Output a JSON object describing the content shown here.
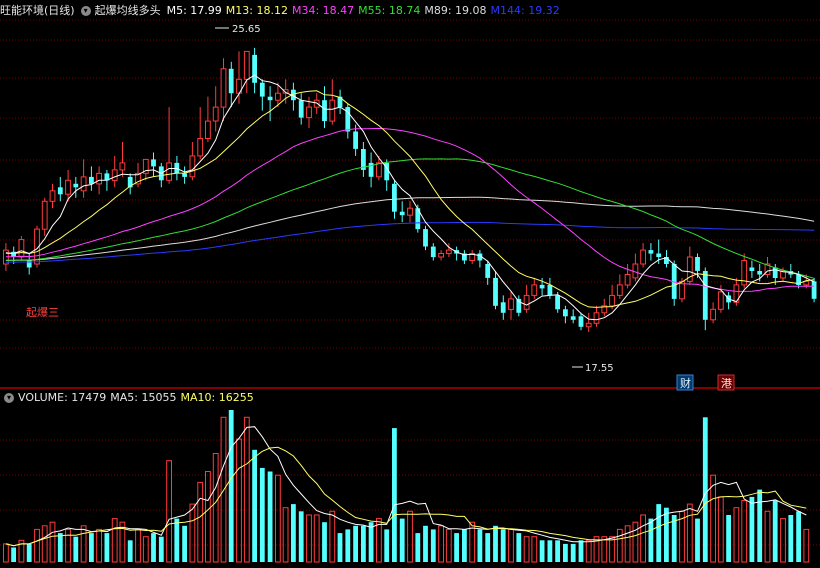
{
  "colors": {
    "bg": "#000000",
    "grid": "#7a0000",
    "up": "#ff3b3b",
    "down": "#54ffff",
    "m5": "#ffffff",
    "m13": "#ffff66",
    "m34": "#ff40ff",
    "m55": "#33dd33",
    "m89": "#dcdcdc",
    "m144": "#2a3aff",
    "ma5": "#ffffff",
    "ma10": "#ffff66",
    "text": "#e6e6e6"
  },
  "header": {
    "title": "旺能环境(日线)",
    "indicator": "起爆均线多头",
    "m5": "M5: 17.99",
    "m13": "M13: 18.12",
    "m34": "M34: 18.47",
    "m55": "M55: 18.74",
    "m89": "M89: 19.08",
    "m144": "M144: 19.32"
  },
  "volume_header": {
    "volume": "VOLUME: 17479",
    "ma5": "MA5: 15055",
    "ma10": "MA10: 16255"
  },
  "annotations": {
    "high": "25.65",
    "low": "17.55",
    "signal": "起爆三",
    "badge1": "财",
    "badge2": "港"
  },
  "icons": {
    "menu": "chevron-down-icon"
  },
  "chart_data": [
    {
      "type": "candlestick",
      "title": "旺能环境(日线)",
      "ylim": [
        16.0,
        26.5
      ],
      "series": [
        "M5",
        "M13",
        "M34",
        "M55",
        "M89",
        "M144"
      ],
      "candles": [
        [
          19.5,
          19.9,
          20.1,
          19.3
        ],
        [
          19.85,
          19.7,
          20.0,
          19.5
        ],
        [
          19.7,
          20.2,
          20.3,
          19.6
        ],
        [
          19.6,
          19.4,
          19.8,
          19.2
        ],
        [
          19.5,
          20.5,
          20.6,
          19.4
        ],
        [
          20.5,
          21.3,
          21.4,
          20.3
        ],
        [
          21.3,
          21.6,
          21.8,
          21.1
        ],
        [
          21.7,
          21.5,
          22.0,
          21.3
        ],
        [
          21.5,
          21.9,
          22.2,
          21.3
        ],
        [
          21.8,
          21.7,
          22.0,
          21.4
        ],
        [
          21.6,
          22.0,
          22.5,
          21.4
        ],
        [
          22.0,
          21.8,
          22.3,
          21.6
        ],
        [
          21.8,
          22.1,
          22.3,
          21.5
        ],
        [
          22.1,
          21.9,
          22.2,
          21.6
        ],
        [
          21.9,
          22.2,
          22.6,
          21.7
        ],
        [
          22.2,
          22.4,
          23.0,
          22.0
        ],
        [
          22.0,
          21.7,
          22.1,
          21.5
        ],
        [
          21.8,
          22.1,
          22.4,
          21.7
        ],
        [
          22.1,
          22.5,
          22.5,
          21.9
        ],
        [
          22.5,
          22.3,
          22.7,
          22.0
        ],
        [
          22.3,
          21.9,
          22.4,
          21.7
        ],
        [
          21.9,
          22.4,
          24.0,
          21.8
        ],
        [
          22.4,
          22.1,
          22.6,
          21.9
        ],
        [
          22.1,
          22.0,
          22.3,
          21.8
        ],
        [
          22.0,
          22.6,
          23.0,
          21.9
        ],
        [
          22.6,
          23.1,
          24.0,
          22.5
        ],
        [
          23.1,
          23.6,
          24.3,
          23.0
        ],
        [
          23.6,
          24.0,
          24.6,
          23.3
        ],
        [
          24.0,
          25.1,
          25.4,
          23.6
        ],
        [
          25.1,
          24.4,
          25.3,
          24.0
        ],
        [
          24.4,
          24.8,
          25.6,
          24.1
        ],
        [
          24.8,
          25.6,
          25.6,
          24.4
        ],
        [
          25.5,
          24.7,
          25.7,
          24.4
        ],
        [
          24.7,
          24.3,
          24.8,
          23.9
        ],
        [
          24.3,
          24.2,
          24.6,
          23.6
        ],
        [
          24.2,
          24.4,
          24.7,
          24.0
        ],
        [
          24.4,
          24.5,
          24.8,
          24.1
        ],
        [
          24.5,
          24.2,
          24.7,
          23.9
        ],
        [
          24.2,
          23.7,
          24.4,
          23.5
        ],
        [
          23.7,
          24.0,
          24.3,
          23.4
        ],
        [
          24.0,
          24.2,
          24.4,
          23.8
        ],
        [
          24.2,
          23.6,
          24.6,
          23.4
        ],
        [
          23.6,
          24.2,
          24.8,
          23.5
        ],
        [
          24.3,
          24.0,
          24.5,
          23.8
        ],
        [
          24.0,
          23.3,
          24.1,
          23.1
        ],
        [
          23.3,
          22.8,
          23.5,
          22.6
        ],
        [
          22.8,
          22.2,
          23.0,
          22.0
        ],
        [
          22.4,
          22.0,
          22.7,
          21.7
        ],
        [
          22.0,
          22.4,
          22.6,
          21.9
        ],
        [
          22.4,
          21.9,
          22.5,
          21.6
        ],
        [
          21.8,
          21.0,
          21.9,
          20.8
        ],
        [
          21.0,
          20.9,
          21.3,
          20.7
        ],
        [
          20.9,
          21.1,
          21.3,
          20.7
        ],
        [
          21.1,
          20.5,
          21.2,
          20.4
        ],
        [
          20.5,
          20.0,
          20.6,
          19.9
        ],
        [
          20.0,
          19.7,
          20.1,
          19.6
        ],
        [
          19.7,
          19.8,
          19.9,
          19.6
        ],
        [
          19.8,
          19.9,
          20.1,
          19.7
        ],
        [
          19.9,
          19.8,
          20.0,
          19.6
        ],
        [
          19.8,
          19.6,
          19.9,
          19.5
        ],
        [
          19.6,
          19.8,
          19.9,
          19.5
        ],
        [
          19.8,
          19.6,
          19.9,
          19.4
        ],
        [
          19.5,
          19.1,
          19.6,
          18.9
        ],
        [
          19.1,
          18.3,
          19.3,
          18.2
        ],
        [
          18.4,
          18.1,
          18.6,
          17.9
        ],
        [
          18.2,
          18.5,
          18.7,
          17.9
        ],
        [
          18.5,
          18.1,
          18.6,
          18.0
        ],
        [
          18.2,
          18.6,
          18.9,
          18.1
        ],
        [
          18.6,
          18.9,
          19.1,
          18.5
        ],
        [
          18.9,
          18.8,
          19.1,
          18.6
        ],
        [
          18.9,
          18.6,
          19.1,
          18.5
        ],
        [
          18.6,
          18.2,
          18.7,
          18.1
        ],
        [
          18.2,
          18.0,
          18.3,
          17.8
        ],
        [
          18.0,
          17.9,
          18.2,
          17.8
        ],
        [
          18.0,
          17.7,
          18.1,
          17.6
        ],
        [
          17.7,
          17.8,
          18.1,
          17.55
        ],
        [
          17.8,
          18.1,
          18.3,
          17.7
        ],
        [
          18.1,
          18.3,
          18.5,
          18.0
        ],
        [
          18.3,
          18.6,
          18.9,
          18.2
        ],
        [
          18.6,
          18.9,
          19.2,
          18.5
        ],
        [
          18.9,
          19.2,
          19.5,
          18.8
        ],
        [
          19.1,
          19.5,
          19.8,
          19.0
        ],
        [
          19.5,
          19.9,
          20.1,
          19.4
        ],
        [
          19.9,
          19.8,
          20.1,
          19.6
        ],
        [
          19.8,
          19.7,
          20.2,
          19.5
        ],
        [
          19.7,
          19.5,
          19.9,
          19.4
        ],
        [
          19.5,
          18.5,
          19.6,
          18.3
        ],
        [
          18.5,
          19.0,
          19.1,
          18.4
        ],
        [
          19.0,
          19.7,
          20.0,
          18.9
        ],
        [
          19.7,
          19.3,
          19.8,
          19.1
        ],
        [
          19.3,
          17.9,
          19.4,
          17.6
        ],
        [
          17.9,
          18.2,
          18.4,
          17.8
        ],
        [
          18.2,
          18.7,
          18.9,
          18.1
        ],
        [
          18.6,
          18.4,
          18.7,
          18.2
        ],
        [
          18.4,
          18.9,
          19.1,
          18.3
        ],
        [
          18.9,
          19.6,
          19.8,
          18.8
        ],
        [
          19.4,
          19.3,
          19.6,
          19.1
        ],
        [
          19.3,
          19.2,
          19.5,
          19.0
        ],
        [
          19.2,
          19.5,
          19.7,
          19.1
        ],
        [
          19.4,
          19.1,
          19.5,
          18.9
        ],
        [
          19.1,
          19.3,
          19.4,
          19.0
        ],
        [
          19.3,
          19.2,
          19.5,
          19.1
        ],
        [
          19.2,
          18.9,
          19.3,
          18.8
        ],
        [
          18.9,
          19.0,
          19.2,
          18.8
        ],
        [
          19.0,
          18.5,
          19.1,
          18.4
        ]
      ],
      "volume": [
        5,
        4,
        6,
        5,
        9,
        10,
        11,
        8,
        9,
        7,
        10,
        8,
        9,
        8,
        12,
        11,
        6,
        9,
        7,
        8,
        7,
        28,
        12,
        10,
        16,
        22,
        25,
        30,
        40,
        42,
        34,
        40,
        31,
        26,
        25,
        24,
        15,
        16,
        14,
        13,
        13,
        11,
        14,
        8,
        9,
        10,
        10,
        11,
        12,
        9,
        37,
        12,
        14,
        8,
        10,
        9,
        10,
        9,
        8,
        9,
        11,
        9,
        8,
        10,
        9,
        9,
        8,
        7,
        7,
        6,
        6,
        6,
        5,
        5,
        6,
        6,
        7,
        7,
        7,
        9,
        10,
        11,
        13,
        12,
        16,
        15,
        13,
        14,
        16,
        12,
        40,
        24,
        18,
        13,
        15,
        17,
        18,
        20,
        14,
        17,
        12,
        13,
        14,
        9
      ]
    }
  ]
}
